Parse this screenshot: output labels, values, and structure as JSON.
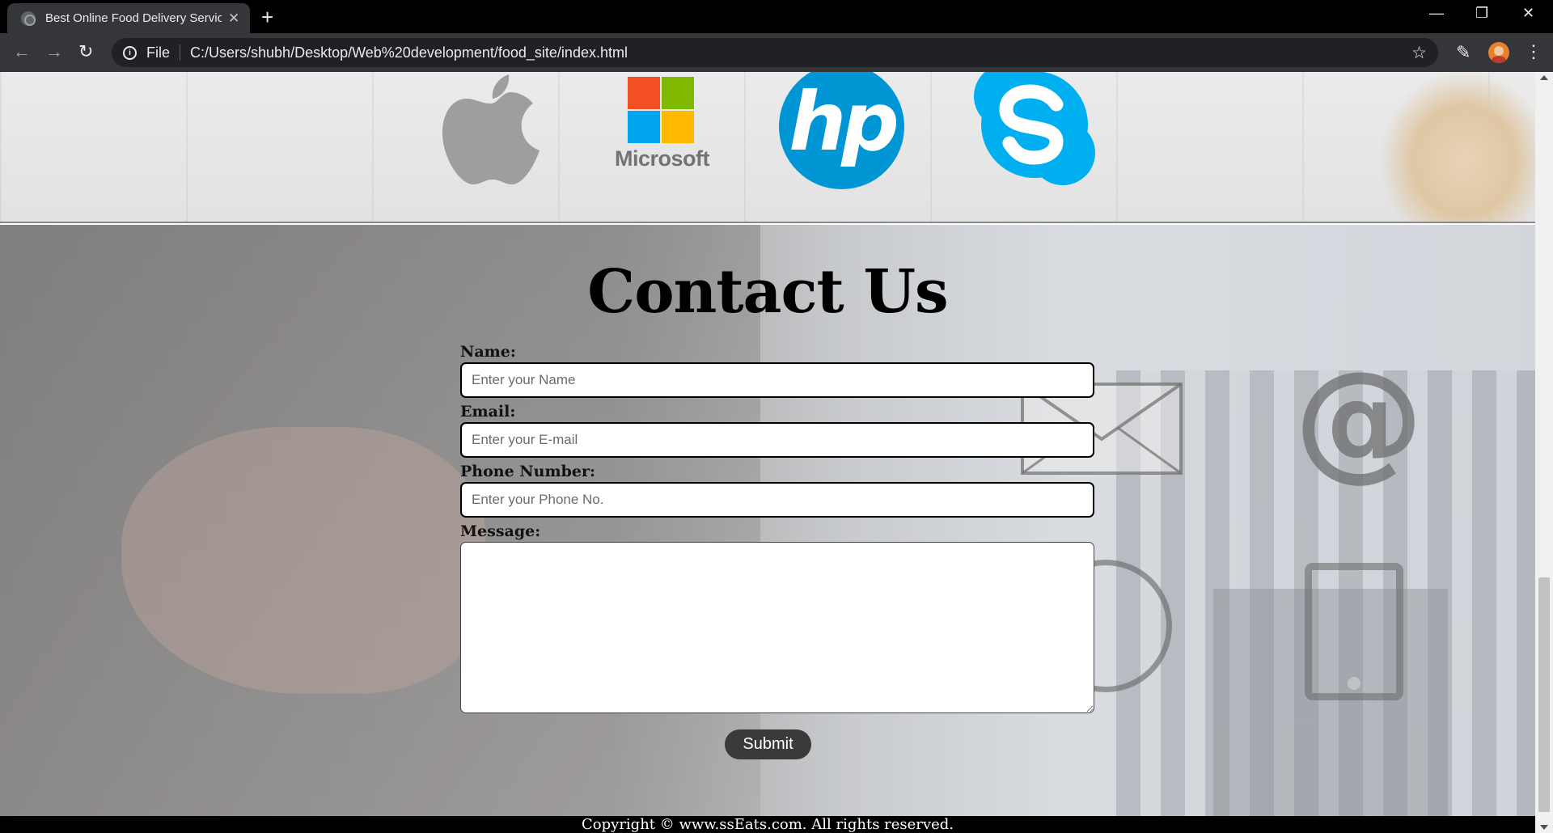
{
  "browser": {
    "tab_title": "Best Online Food Delivery Service",
    "tab_close_glyph": "✕",
    "new_tab_glyph": "+",
    "scheme_label": "File",
    "url": "C:/Users/shubh/Desktop/Web%20development/food_site/index.html",
    "window_controls": {
      "minimize": "—",
      "restore": "❐",
      "close": "✕"
    }
  },
  "clients": {
    "logos": [
      {
        "name": "Apple",
        "icon": "apple-logo"
      },
      {
        "name": "Microsoft",
        "icon": "microsoft-logo",
        "wordmark": "Microsoft"
      },
      {
        "name": "HP",
        "icon": "hp-logo",
        "wordmark": "hp"
      },
      {
        "name": "Skype",
        "icon": "skype-logo"
      }
    ]
  },
  "contact": {
    "title": "Contact Us",
    "fields": {
      "name": {
        "label": "Name:",
        "placeholder": "Enter your Name"
      },
      "email": {
        "label": "Email:",
        "placeholder": "Enter your E-mail"
      },
      "phone": {
        "label": "Phone Number:",
        "placeholder": "Enter your Phone No."
      },
      "message": {
        "label": "Message:",
        "placeholder": ""
      }
    },
    "submit_label": "Submit"
  },
  "footer": {
    "copyright": "Copyright © www.ssEats.com. All rights reserved."
  },
  "colors": {
    "submit_bg": "#3a3a3a",
    "footer_bg": "#000000",
    "hp_blue": "#0096d6",
    "skype_blue": "#00aff0"
  }
}
